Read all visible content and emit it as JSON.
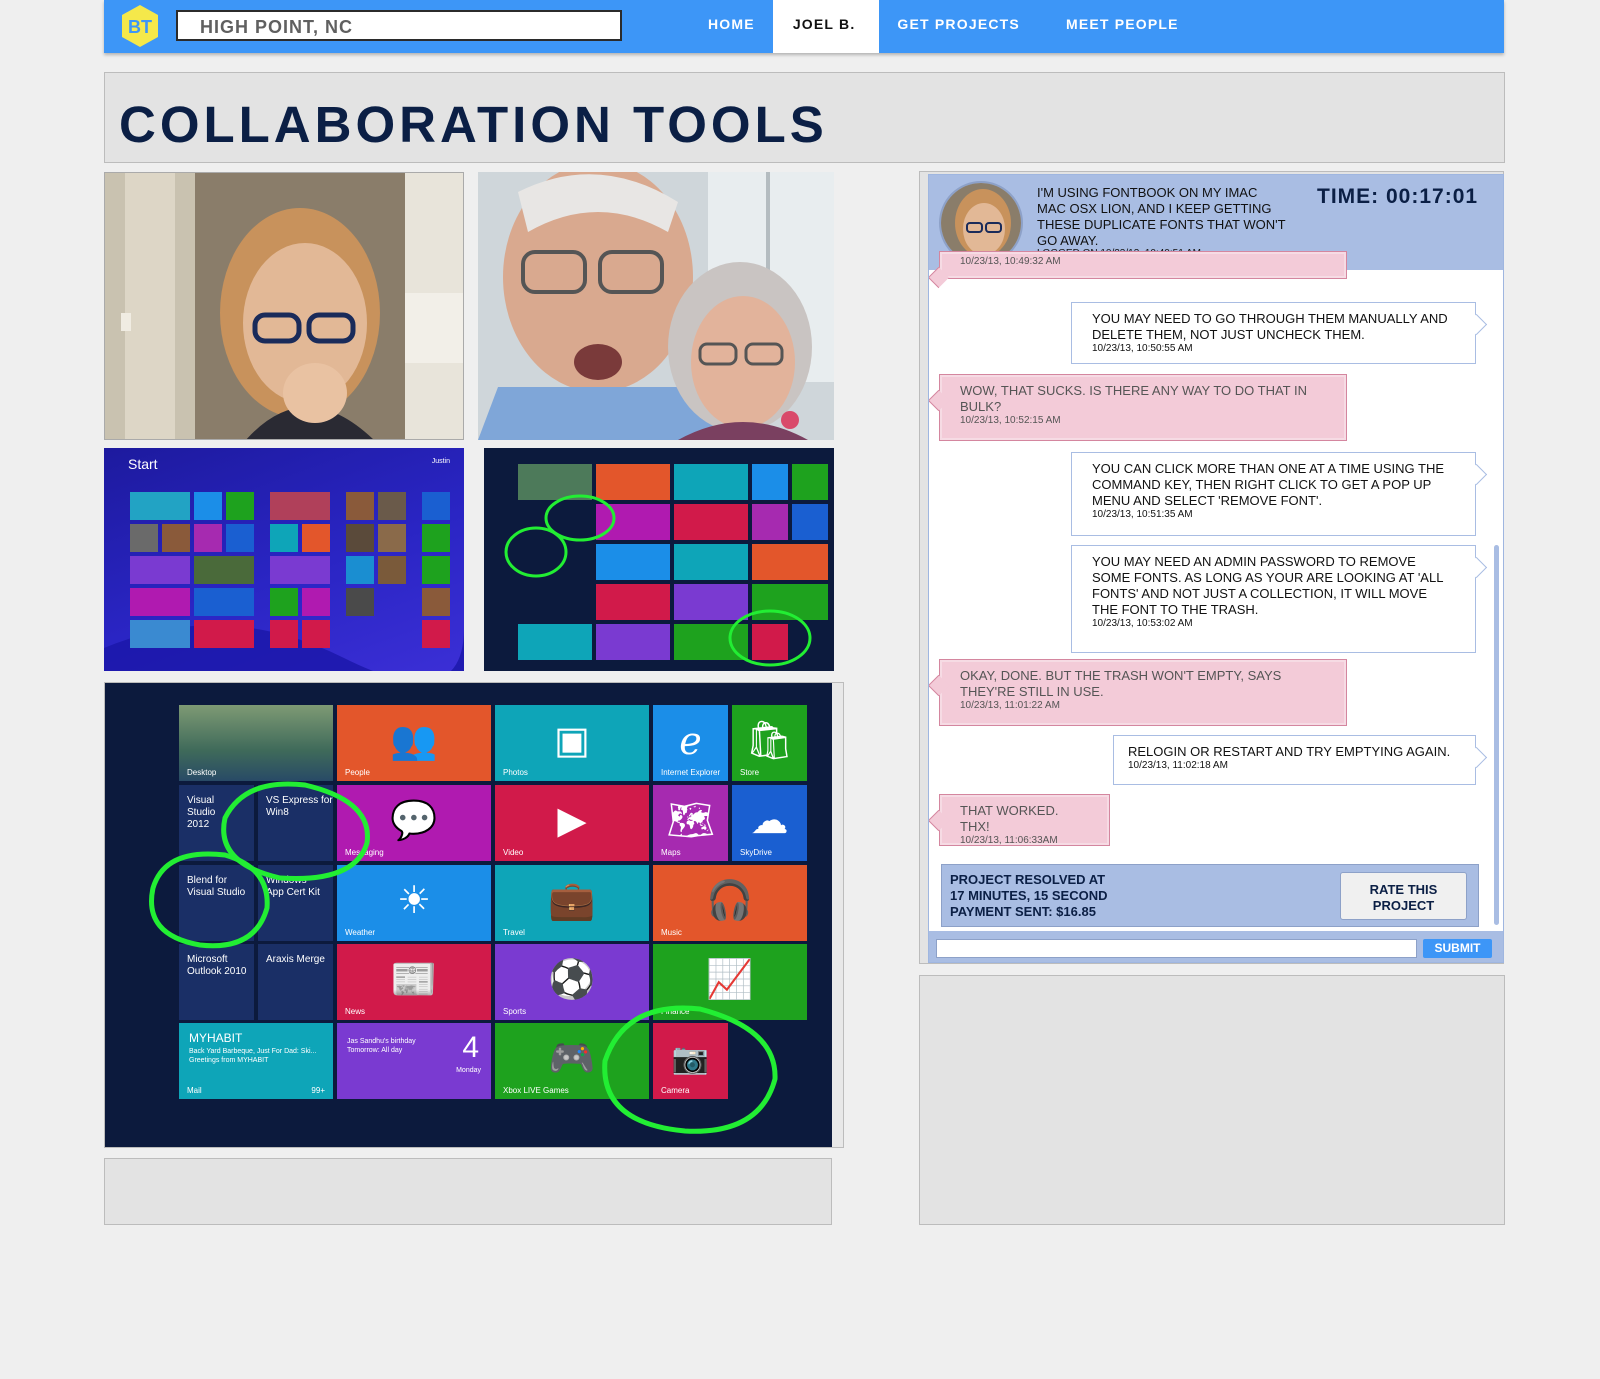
{
  "header": {
    "logo_text": "BT",
    "location": "HIGH POINT, NC",
    "nav": [
      {
        "label": "HOME"
      },
      {
        "label": "JOEL B."
      },
      {
        "label": "GET PROJECTS"
      },
      {
        "label": "MEET PEOPLE"
      }
    ]
  },
  "page_title": "COLLABORATION TOOLS",
  "screens": {
    "start_label": "Start",
    "user_label": "Justin",
    "tiles": [
      {
        "name": "Desktop",
        "glyph": "",
        "color": "#3a6a3a"
      },
      {
        "name": "People",
        "glyph": "👥",
        "color": "#e3562b"
      },
      {
        "name": "Photos",
        "glyph": "🖼",
        "color": "#0ea5b8"
      },
      {
        "name": "Internet Explorer",
        "glyph": "e",
        "color": "#1b8ee8"
      },
      {
        "name": "Store",
        "glyph": "🛍",
        "color": "#1ea21e"
      },
      {
        "name": "VS Express for Win8",
        "glyph": "",
        "color": "#1a2f66"
      },
      {
        "name": "Messaging",
        "glyph": "💬",
        "color": "#b01ab0"
      },
      {
        "name": "Video",
        "glyph": "▶",
        "color": "#d11a4a"
      },
      {
        "name": "Maps",
        "glyph": "🗺",
        "color": "#a62ab0"
      },
      {
        "name": "SkyDrive",
        "glyph": "☁",
        "color": "#1a5fd1"
      },
      {
        "name": "Blend for Visual Studio",
        "glyph": "",
        "color": "#1a2f66"
      },
      {
        "name": "Windows App Cert Kit",
        "glyph": "",
        "color": "#1a2f66"
      },
      {
        "name": "Weather",
        "glyph": "☀",
        "color": "#1b8ee8"
      },
      {
        "name": "Travel",
        "glyph": "💼",
        "color": "#0ea5b8"
      },
      {
        "name": "Music",
        "glyph": "🎧",
        "color": "#e3562b"
      },
      {
        "name": "Microsoft Outlook 2010",
        "glyph": "",
        "color": "#1a2f66"
      },
      {
        "name": "Araxis Merge",
        "glyph": "",
        "color": "#1a2f66"
      },
      {
        "name": "News",
        "glyph": "📰",
        "color": "#d11a4a"
      },
      {
        "name": "Sports",
        "glyph": "⚽",
        "color": "#7a3ad1"
      },
      {
        "name": "Finance",
        "glyph": "📈",
        "color": "#1ea21e"
      },
      {
        "name": "Mail",
        "glyph": "",
        "color": "#0ea5b8"
      },
      {
        "name": "Calendar",
        "glyph": "4",
        "color": "#7a3ad1"
      },
      {
        "name": "Xbox LIVE Games",
        "glyph": "🎮",
        "color": "#1ea21e"
      },
      {
        "name": "Camera",
        "glyph": "📷",
        "color": "#d11a4a"
      }
    ],
    "mail_title": "MYHABIT",
    "mail_body": "Back Yard Barbeque, Just For Dad: Ski... Greetings from MYHABIT",
    "mail_count": "99+",
    "calendar_text": "Jas Sandhu's birthday Tomorrow: All day",
    "calendar_day": "Monday"
  },
  "chat": {
    "question": "I'M USING FONTBOOK ON MY IMAC MAC OSX LION, AND I KEEP GETTING THESE DUPLICATE FONTS THAT WON'T GO AWAY.",
    "logged": "LOGGED ON 10/23/13, 10:40:51 AM",
    "timer": "TIME: 00:17:01",
    "messages": [
      {
        "from": "them",
        "text": "",
        "time": "10/23/13, 10:49:32 AM"
      },
      {
        "from": "me",
        "text": "YOU MAY NEED TO GO THROUGH THEM MANUALLY AND DELETE THEM, NOT JUST UNCHECK THEM.",
        "time": "10/23/13, 10:50:55 AM"
      },
      {
        "from": "them",
        "text": "WOW, THAT SUCKS. IS THERE ANY WAY TO DO THAT IN BULK?",
        "time": "10/23/13, 10:52:15 AM"
      },
      {
        "from": "me",
        "text": "YOU CAN CLICK MORE THAN ONE AT A TIME USING THE COMMAND KEY, THEN RIGHT CLICK TO GET A POP UP MENU AND SELECT 'REMOVE FONT'.",
        "time": "10/23/13, 10:51:35 AM"
      },
      {
        "from": "me",
        "text": "YOU MAY NEED AN ADMIN PASSWORD TO REMOVE SOME FONTS. AS LONG AS YOUR ARE LOOKING AT 'ALL FONTS' AND NOT JUST A COLLECTION, IT WILL MOVE THE FONT TO THE TRASH.",
        "time": "10/23/13, 10:53:02 AM"
      },
      {
        "from": "them",
        "text": "OKAY, DONE. BUT THE TRASH WON'T EMPTY, SAYS THEY'RE STILL IN USE.",
        "time": "10/23/13, 11:01:22 AM"
      },
      {
        "from": "me",
        "text": "RELOGIN OR RESTART AND TRY EMPTYING AGAIN.",
        "time": "10/23/13, 11:02:18 AM"
      },
      {
        "from": "them",
        "text": "THAT WORKED. THX!",
        "time": "10/23/13, 11:06:33AM"
      }
    ],
    "resolved_line1": "PROJECT RESOLVED AT",
    "resolved_line2": "17 MINUTES, 15 SECOND",
    "payment": "PAYMENT SENT: $16.85",
    "rate_label": "RATE THIS PROJECT",
    "input_placeholder": "",
    "submit_label": "SUBMIT"
  },
  "colors": {
    "brand_blue": "#3d96f7",
    "title_navy": "#0b1f45",
    "chat_header": "#a9bde3",
    "their_bubble": "#f3cbd8",
    "circle_green": "#22ee33"
  }
}
